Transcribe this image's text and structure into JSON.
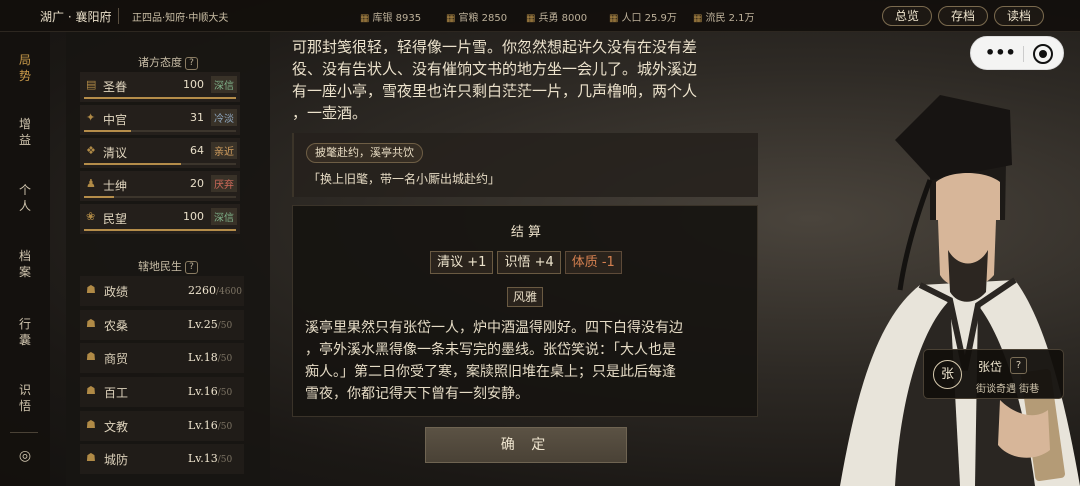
{
  "topbar": {
    "place": "湖广 · 襄阳府",
    "rank": "正四品·知府·中顺大夫",
    "resources": [
      {
        "icon": "treasury-icon",
        "glyph": "▦",
        "label": "库银 8935"
      },
      {
        "icon": "official-icon",
        "glyph": "▦",
        "label": "官粮 2850"
      },
      {
        "icon": "soldier-icon",
        "glyph": "▦",
        "label": "兵勇 8000"
      },
      {
        "icon": "population-icon",
        "glyph": "▦",
        "label": "人口 25.9万"
      },
      {
        "icon": "refugee-icon",
        "glyph": "▦",
        "label": "流民 2.1万"
      }
    ],
    "buttons": {
      "overview": "总览",
      "save": "存档",
      "load": "读档"
    }
  },
  "nav": {
    "items": [
      "局势",
      "增益",
      "个人",
      "档案",
      "行囊",
      "识悟"
    ],
    "active": 0,
    "settings_glyph": "◎"
  },
  "stance": {
    "title": "诸方态度",
    "help": "?",
    "rows": [
      {
        "name": "圣眷",
        "value": 100,
        "tag": "深信",
        "tag_color": "#7fb28a",
        "fill": 1.0,
        "glyph": "▤"
      },
      {
        "name": "中官",
        "value": 31,
        "tag": "冷淡",
        "tag_color": "#8fa7c0",
        "fill": 0.31,
        "glyph": "✦"
      },
      {
        "name": "清议",
        "value": 64,
        "tag": "亲近",
        "tag_color": "#d6a160",
        "fill": 0.64,
        "glyph": "❖"
      },
      {
        "name": "士绅",
        "value": 20,
        "tag": "厌弃",
        "tag_color": "#d06a5a",
        "fill": 0.2,
        "glyph": "♟"
      },
      {
        "name": "民望",
        "value": 100,
        "tag": "深信",
        "tag_color": "#7fb28a",
        "fill": 1.0,
        "glyph": "❀"
      }
    ]
  },
  "livelihood": {
    "title": "辖地民生",
    "help": "?",
    "rows": [
      {
        "name": "政绩",
        "value": "2260",
        "max": "/4600",
        "glyph": "☗"
      },
      {
        "name": "农桑",
        "value": "Lv.25",
        "max": "/50",
        "glyph": "☗"
      },
      {
        "name": "商贸",
        "value": "Lv.18",
        "max": "/50",
        "glyph": "☗"
      },
      {
        "name": "百工",
        "value": "Lv.16",
        "max": "/50",
        "glyph": "☗"
      },
      {
        "name": "文教",
        "value": "Lv.16",
        "max": "/50",
        "glyph": "☗"
      },
      {
        "name": "城防",
        "value": "Lv.13",
        "max": "/50",
        "glyph": "☗"
      }
    ]
  },
  "story": {
    "lines": [
      "可那封笺很轻，轻得像一片雪。你忽然想起许久没有在没有差",
      "役、没有告状人、没有催饷文书的地方坐一会儿了。城外溪边",
      "有一座小亭，雪夜里也许只剩白茫茫一片，几声橹响，两个人",
      "，一壶酒。"
    ]
  },
  "choice": {
    "tag": "披氅赴约，溪亭共饮",
    "text": "「换上旧氅，带一名小厮出城赴约」"
  },
  "result": {
    "title": "结 算",
    "chips": [
      {
        "label": "清议 +1",
        "negative": false
      },
      {
        "label": "识悟 +4",
        "negative": false
      },
      {
        "label": "体质 -1",
        "negative": true
      }
    ],
    "trait": "风雅",
    "text": [
      "溪亭里果然只有张岱一人，炉中酒温得刚好。四下白得没有边",
      "，亭外溪水黑得像一条未写完的墨线。张岱笑说：「大人也是",
      "痴人。」第二日你受了寒，案牍照旧堆在桌上；只是此后每逢",
      "雪夜，你都记得天下曾有一刻安静。"
    ]
  },
  "confirm": "确 定",
  "npc": {
    "avatar": "张",
    "name": "张岱",
    "help": "?",
    "tags": "街谈奇遇  街巷"
  },
  "capsule": {
    "more": "•••",
    "close": ""
  }
}
